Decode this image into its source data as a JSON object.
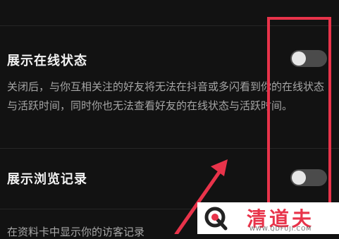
{
  "settings": [
    {
      "title": "展示在线状态",
      "description": "关闭后，与你互相关注的好友将无法在抖音或多闪看到你的在线状态与活跃时间，同时你也无法查看好友的在线状态与活跃时间。",
      "enabled": false
    },
    {
      "title": "展示浏览记录",
      "enabled": false
    }
  ],
  "next_row_partial": "在资料卡中显示你的访客记录",
  "annotation": {
    "color": "#e8334a"
  },
  "watermark": {
    "brand": "清道夫",
    "url": "WWW.QDFUJI.COM"
  },
  "icons": [
    "toggle-switch",
    "red-arrow",
    "q-logo"
  ]
}
